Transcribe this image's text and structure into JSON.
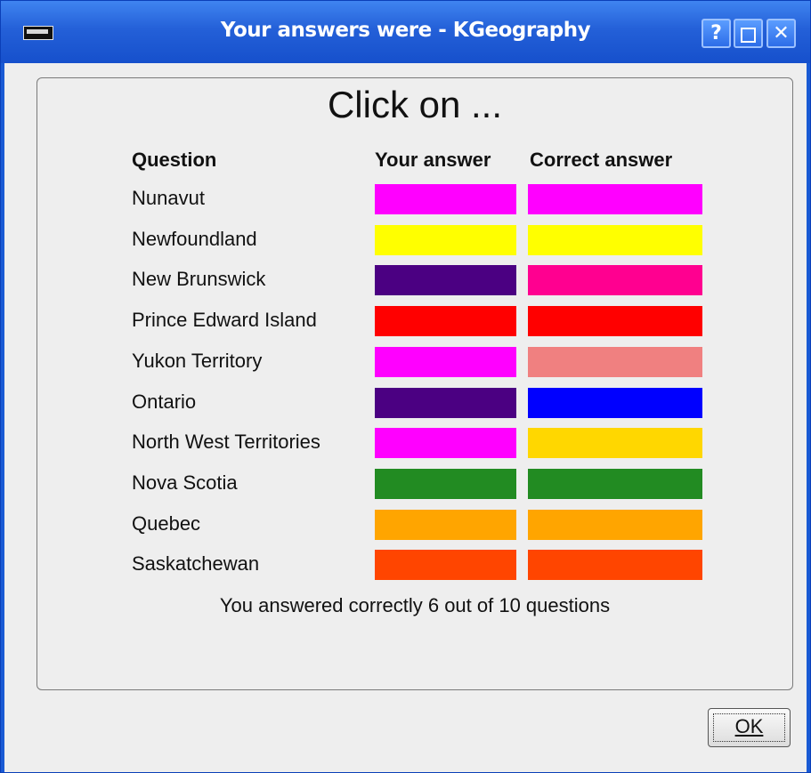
{
  "window": {
    "title": "Your answers were - KGeography"
  },
  "titlebar_buttons": {
    "help": "?",
    "close": "✕"
  },
  "dialog": {
    "heading": "Click on ...",
    "headers": {
      "question": "Question",
      "your_answer": "Your answer",
      "correct_answer": "Correct answer"
    },
    "rows": [
      {
        "question": "Nunavut",
        "your_color": "#ff00ff",
        "correct_color": "#ff00ff"
      },
      {
        "question": "Newfoundland",
        "your_color": "#ffff00",
        "correct_color": "#ffff00"
      },
      {
        "question": "New Brunswick",
        "your_color": "#4b0082",
        "correct_color": "#ff0090"
      },
      {
        "question": "Prince Edward Island",
        "your_color": "#ff0000",
        "correct_color": "#ff0000"
      },
      {
        "question": "Yukon Territory",
        "your_color": "#ff00ff",
        "correct_color": "#f08080"
      },
      {
        "question": "Ontario",
        "your_color": "#4b0082",
        "correct_color": "#0000ff"
      },
      {
        "question": "North West Territories",
        "your_color": "#ff00ff",
        "correct_color": "#ffd700"
      },
      {
        "question": "Nova Scotia",
        "your_color": "#228b22",
        "correct_color": "#228b22"
      },
      {
        "question": "Quebec",
        "your_color": "#ffa500",
        "correct_color": "#ffa500"
      },
      {
        "question": "Saskatchewan",
        "your_color": "#ff4500",
        "correct_color": "#ff4500"
      }
    ],
    "summary": "You answered correctly 6 out of 10 questions",
    "ok_label": "OK"
  }
}
